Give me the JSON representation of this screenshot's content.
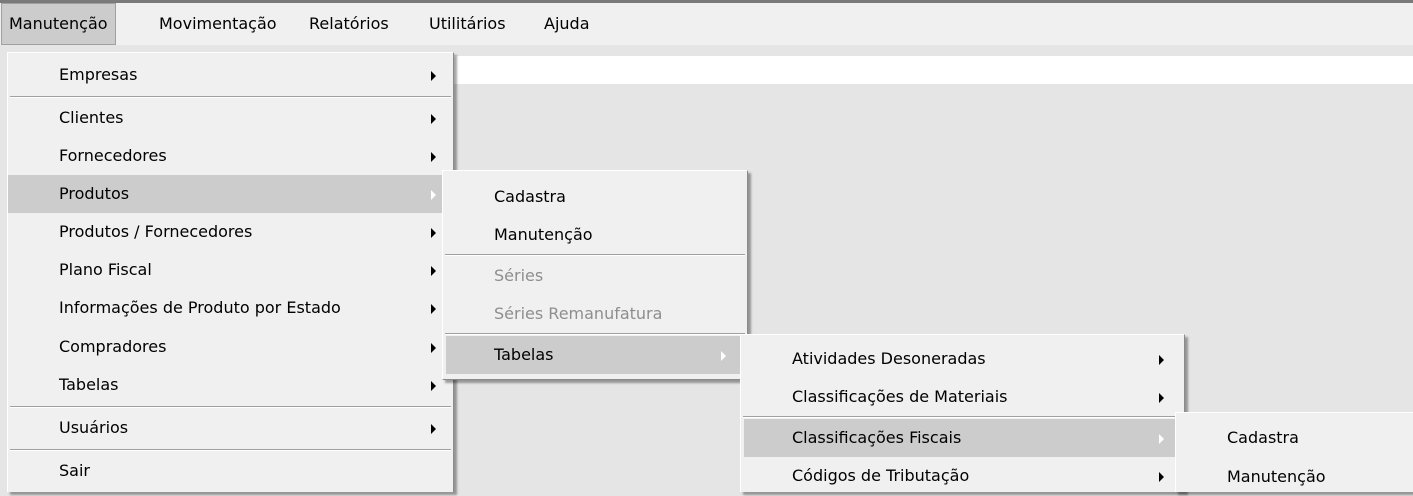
{
  "menubar": {
    "items": [
      {
        "label": "Manutenção"
      },
      {
        "label": "Movimentação"
      },
      {
        "label": "Relatórios"
      },
      {
        "label": "Utilitários"
      },
      {
        "label": "Ajuda"
      }
    ]
  },
  "menu_manutencao": {
    "items": [
      {
        "label": "Empresas"
      },
      {
        "label": "Clientes"
      },
      {
        "label": "Fornecedores"
      },
      {
        "label": "Produtos"
      },
      {
        "label": "Produtos / Fornecedores"
      },
      {
        "label": "Plano Fiscal"
      },
      {
        "label": "Informações de Produto por Estado"
      },
      {
        "label": "Compradores"
      },
      {
        "label": "Tabelas"
      },
      {
        "label": "Usuários"
      },
      {
        "label": "Sair"
      }
    ]
  },
  "menu_produtos": {
    "items": [
      {
        "label": "Cadastra"
      },
      {
        "label": "Manutenção"
      },
      {
        "label": "Séries"
      },
      {
        "label": "Séries Remanufatura"
      },
      {
        "label": "Tabelas"
      }
    ]
  },
  "menu_tabelas": {
    "items": [
      {
        "label": "Atividades Desoneradas"
      },
      {
        "label": "Classificações de Materiais"
      },
      {
        "label": "Classificações Fiscais"
      },
      {
        "label": "Códigos de Tributação"
      }
    ]
  },
  "menu_classificacoes": {
    "items": [
      {
        "label": "Cadastra"
      },
      {
        "label": "Manutenção"
      }
    ]
  }
}
